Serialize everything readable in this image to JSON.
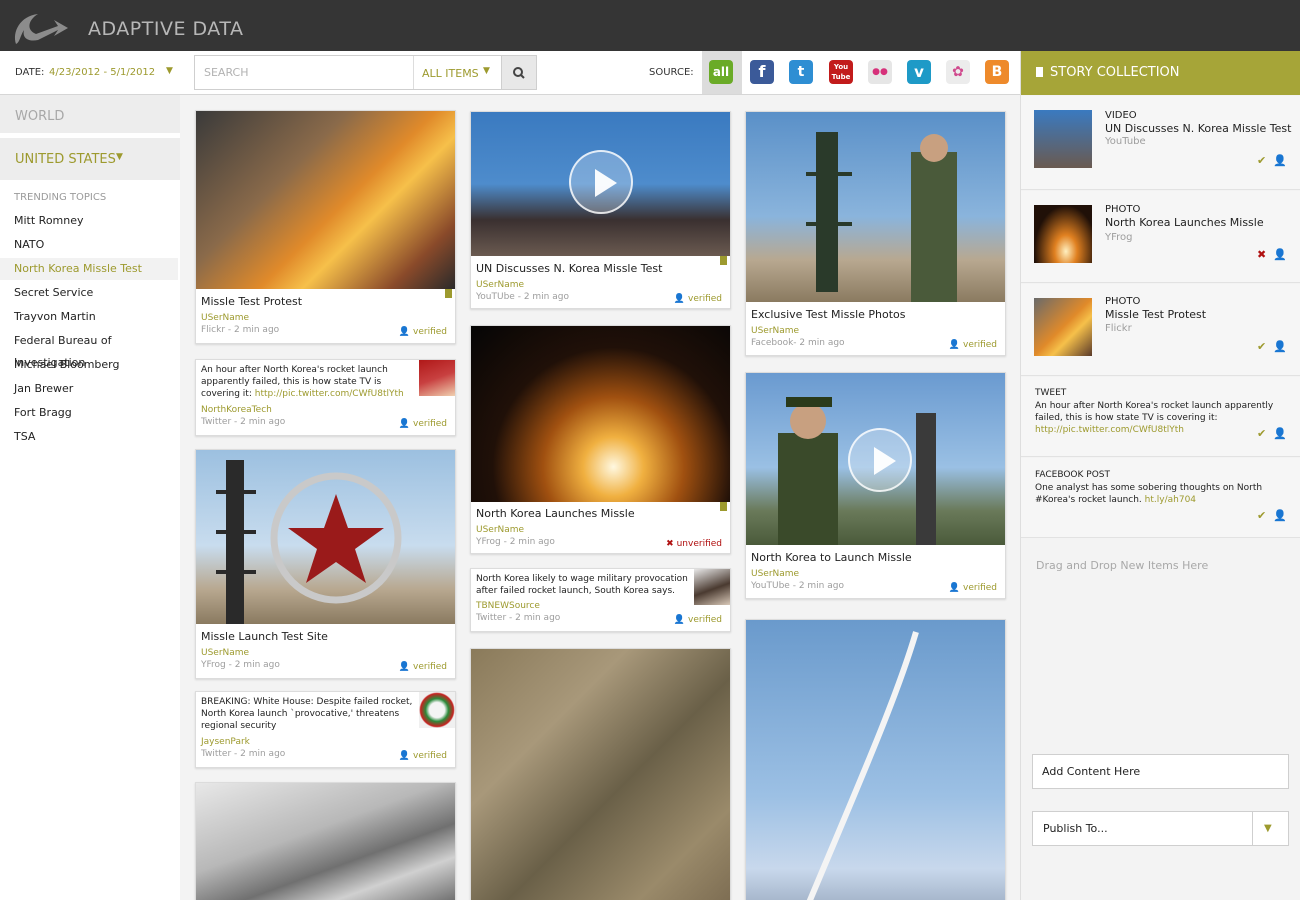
{
  "app": {
    "brand": "ADAPTIVE DATA"
  },
  "toolbar": {
    "date_label": "DATE:",
    "date_value": "4/23/2012 - 5/1/2012",
    "search_placeholder": "SEARCH",
    "filter_value": "ALL ITEMS",
    "source_label": "SOURCE:",
    "sources": [
      {
        "name": "all",
        "label": "all",
        "color": "#6aab27"
      },
      {
        "name": "facebook",
        "label": "f",
        "color": "#3b5a99"
      },
      {
        "name": "twitter",
        "label": "t",
        "color": "#2e8ed3"
      },
      {
        "name": "youtube",
        "label": "You Tube",
        "color": "#c21b1b"
      },
      {
        "name": "flickr",
        "label": "●●",
        "color": "#e6e6e6"
      },
      {
        "name": "vimeo",
        "label": "v",
        "color": "#1e9ac7"
      },
      {
        "name": "picasa",
        "label": "✿",
        "color": "#ececec"
      },
      {
        "name": "blogger",
        "label": "B",
        "color": "#ee8a2b"
      }
    ]
  },
  "nav": {
    "world": "WORLD",
    "region": "UNITED STATES",
    "trending_title": "TRENDING TOPICS",
    "topics": [
      "Mitt Romney",
      "NATO",
      "North Korea Missle Test",
      "Secret Service",
      "Trayvon Martin",
      "Federal Bureau of Investigation",
      "Michael Bloomberg",
      "Jan Brewer",
      "Fort Bragg",
      "TSA"
    ],
    "active_topic": "North Korea Missle Test"
  },
  "feed": {
    "c1": {
      "title": "Missle Test Protest",
      "user": "USerName",
      "meta": "Flickr - 2 min ago",
      "status": "verified"
    },
    "c2": {
      "text": "An hour after North Korea's rocket launch apparently failed, this is how state TV is covering it:",
      "link": "http://pic.twitter.com/CWfU8tlYth",
      "user": "NorthKoreaTech",
      "meta": "Twitter - 2 min ago",
      "status": "verified"
    },
    "c3": {
      "title": "Missle Launch Test Site",
      "user": "USerName",
      "meta": "YFrog - 2 min ago",
      "status": "verified"
    },
    "c4": {
      "text": "BREAKING: White House: Despite failed rocket, North Korea launch `provocative,' threatens regional security",
      "user": "JaysenPark",
      "meta": "Twitter - 2 min ago",
      "status": "verified"
    },
    "c5": {
      "title": "UN Discusses N. Korea Missle Test",
      "user": "USerName",
      "meta": "YouTUbe - 2 min ago",
      "status": "verified"
    },
    "c6": {
      "title": "North Korea Launches Missle",
      "user": "USerName",
      "meta": "YFrog - 2 min ago",
      "status": "unverified"
    },
    "c7": {
      "text": "North Korea likely to wage military provocation after failed rocket launch, South Korea says.",
      "user": "TBNEWSource",
      "meta": "Twitter - 2 min ago",
      "status": "verified"
    },
    "c8": {
      "title": "Exclusive Test Missle Photos",
      "user": "USerName",
      "meta": "Facebook- 2 min ago",
      "status": "verified"
    },
    "c9": {
      "title": "North Korea to Launch Missle",
      "user": "USerName",
      "meta": "YouTUbe - 2 min ago",
      "status": "verified"
    }
  },
  "story": {
    "header": "STORY COLLECTION",
    "items": [
      {
        "type": "VIDEO",
        "title": "UN Discusses N. Korea Missle Test",
        "source": "YouTube"
      },
      {
        "type": "PHOTO",
        "title": "North Korea Launches Missle",
        "source": "YFrog"
      },
      {
        "type": "PHOTO",
        "title": "Missle Test Protest",
        "source": "Flickr"
      }
    ],
    "tweet": {
      "type": "TWEET",
      "text": "An hour after North Korea's rocket launch apparently failed, this is how state TV is covering it:",
      "link": "http://pic.twitter.com/CWfU8tlYth"
    },
    "fbpost": {
      "type": "FACEBOOK POST",
      "text": "One analyst has some sobering thoughts on North #Korea's rocket launch.",
      "link": "ht.ly/ah704"
    },
    "drop_hint": "Drag and Drop New Items Here",
    "add_content": "Add Content Here",
    "publish": "Publish To..."
  },
  "colors": {
    "accent": "#9d9a2e",
    "header_bg": "#353535",
    "story_header": "#a6a538",
    "error": "#b01010"
  }
}
